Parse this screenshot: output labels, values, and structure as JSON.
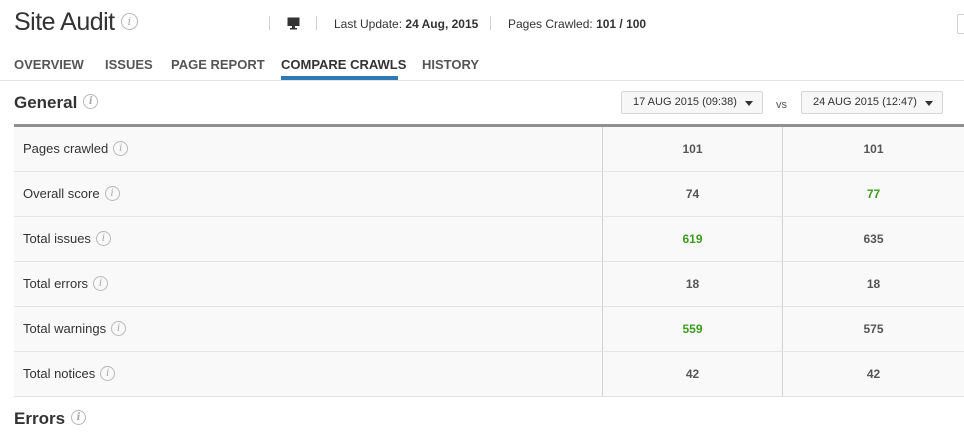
{
  "header": {
    "title": "Site Audit",
    "last_update_label": "Last Update:",
    "last_update_value": "24 Aug, 2015",
    "pages_crawled_label": "Pages Crawled:",
    "pages_crawled_value": "101 / 100"
  },
  "tabs": [
    {
      "label": "OVERVIEW"
    },
    {
      "label": "ISSUES"
    },
    {
      "label": "PAGE REPORT"
    },
    {
      "label": "COMPARE CRAWLS"
    },
    {
      "label": "HISTORY"
    }
  ],
  "active_tab": "COMPARE CRAWLS",
  "general": {
    "title": "General",
    "crawl_a": "17 AUG 2015 (09:38)",
    "vs_label": "vs",
    "crawl_b": "24 AUG 2015 (12:47)"
  },
  "rows": [
    {
      "label": "Pages crawled",
      "a": "101",
      "b": "101",
      "better": ""
    },
    {
      "label": "Overall score",
      "a": "74",
      "b": "77",
      "better": "b"
    },
    {
      "label": "Total issues",
      "a": "619",
      "b": "635",
      "better": "a"
    },
    {
      "label": "Total errors",
      "a": "18",
      "b": "18",
      "better": ""
    },
    {
      "label": "Total warnings",
      "a": "559",
      "b": "575",
      "better": "a"
    },
    {
      "label": "Total notices",
      "a": "42",
      "b": "42",
      "better": ""
    }
  ],
  "errors": {
    "title": "Errors"
  },
  "colors": {
    "accent": "#2f79b5",
    "improved": "#3c9b1e",
    "table_border": "#8f8f8f"
  },
  "icons": [
    "info-icon",
    "monitor-icon",
    "dropdown-caret-icon"
  ]
}
